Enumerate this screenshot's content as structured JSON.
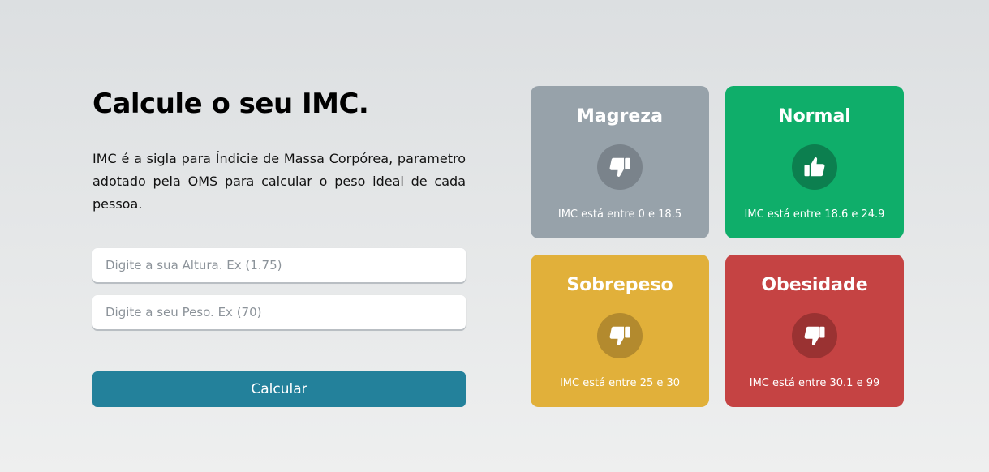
{
  "header": {
    "title": "Calcule o seu IMC."
  },
  "description": "IMC é a sigla para Índicie de Massa Corpórea, parametro adotado pela OMS para calcular o peso ideal de cada pessoa.",
  "form": {
    "height_placeholder": "Digite a sua Altura. Ex (1.75)",
    "weight_placeholder": "Digite a seu Peso. Ex (70)",
    "height_value": "",
    "weight_value": "",
    "submit_label": "Calcular"
  },
  "cards": [
    {
      "title": "Magreza",
      "icon": "thumbs-down-icon",
      "range": "IMC está entre 0 e 18.5",
      "color": "#97a2aa"
    },
    {
      "title": "Normal",
      "icon": "thumbs-up-icon",
      "range": "IMC está entre 18.6 e 24.9",
      "color": "#0fae6a"
    },
    {
      "title": "Sobrepeso",
      "icon": "thumbs-down-icon",
      "range": "IMC está entre 25 e 30",
      "color": "#e1b03a"
    },
    {
      "title": "Obesidade",
      "icon": "thumbs-down-icon",
      "range": "IMC está entre 30.1 e 99",
      "color": "#c54343"
    }
  ],
  "colors": {
    "button": "#23819b"
  }
}
